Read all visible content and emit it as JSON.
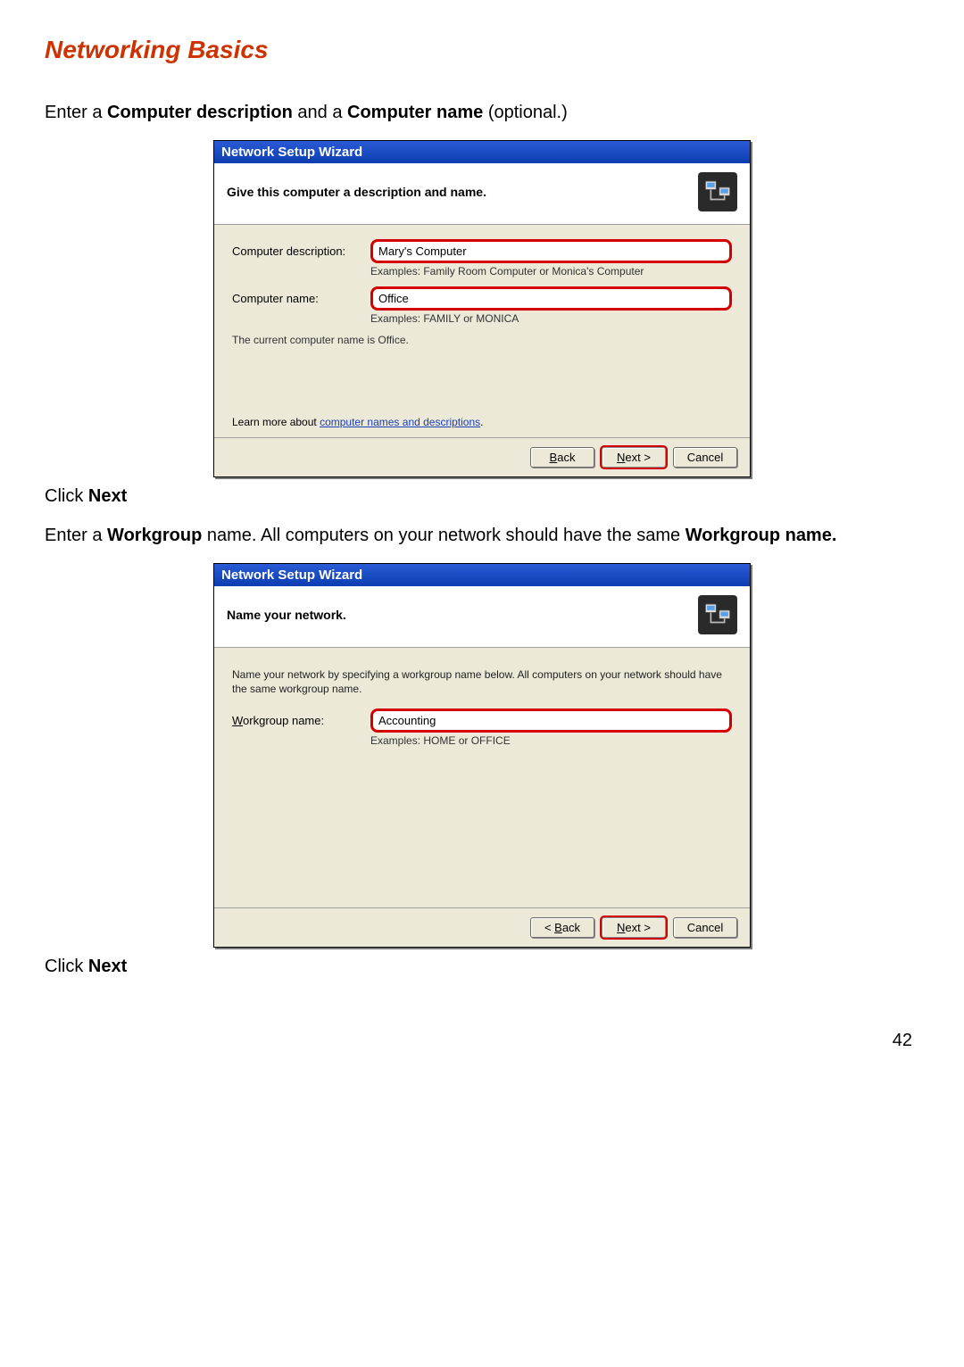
{
  "page": {
    "title": "Networking Basics",
    "number": "42"
  },
  "instructions": {
    "i1_pre": "Enter a ",
    "i1_b1": "Computer description",
    "i1_mid": " and a ",
    "i1_b2": "Computer name",
    "i1_post": " (optional.)",
    "click_next_1": "Click ",
    "click_next_1b": "Next",
    "i2_pre": "Enter a ",
    "i2_b1": "Workgroup",
    "i2_mid": " name.  All computers on your network should have the same ",
    "i2_b2": "Workgroup name.",
    "click_next_2": "Click ",
    "click_next_2b": "Next"
  },
  "wizard1": {
    "title": "Network Setup Wizard",
    "header": "Give this computer a description and name.",
    "desc_label": "Computer description:",
    "desc_value": "Mary's Computer",
    "desc_hint": "Examples: Family Room Computer or Monica's Computer",
    "name_label": "Computer name:",
    "name_value": "Office",
    "name_hint": "Examples: FAMILY or MONICA",
    "current_name": "The current computer name is  Office.",
    "learn_pre": "Learn more about ",
    "learn_link": "computer names and descriptions",
    "learn_post": ".",
    "back": "< Back",
    "next": "Next >",
    "cancel": "Cancel"
  },
  "wizard2": {
    "title": "Network Setup Wizard",
    "header": "Name your network.",
    "body": "Name your network by specifying a workgroup name below. All computers on your network should have the same workgroup name.",
    "wg_label": "Workgroup name:",
    "wg_value": "Accounting",
    "wg_hint": "Examples: HOME or OFFICE",
    "back": "< Back",
    "next": "Next >",
    "cancel": "Cancel"
  }
}
